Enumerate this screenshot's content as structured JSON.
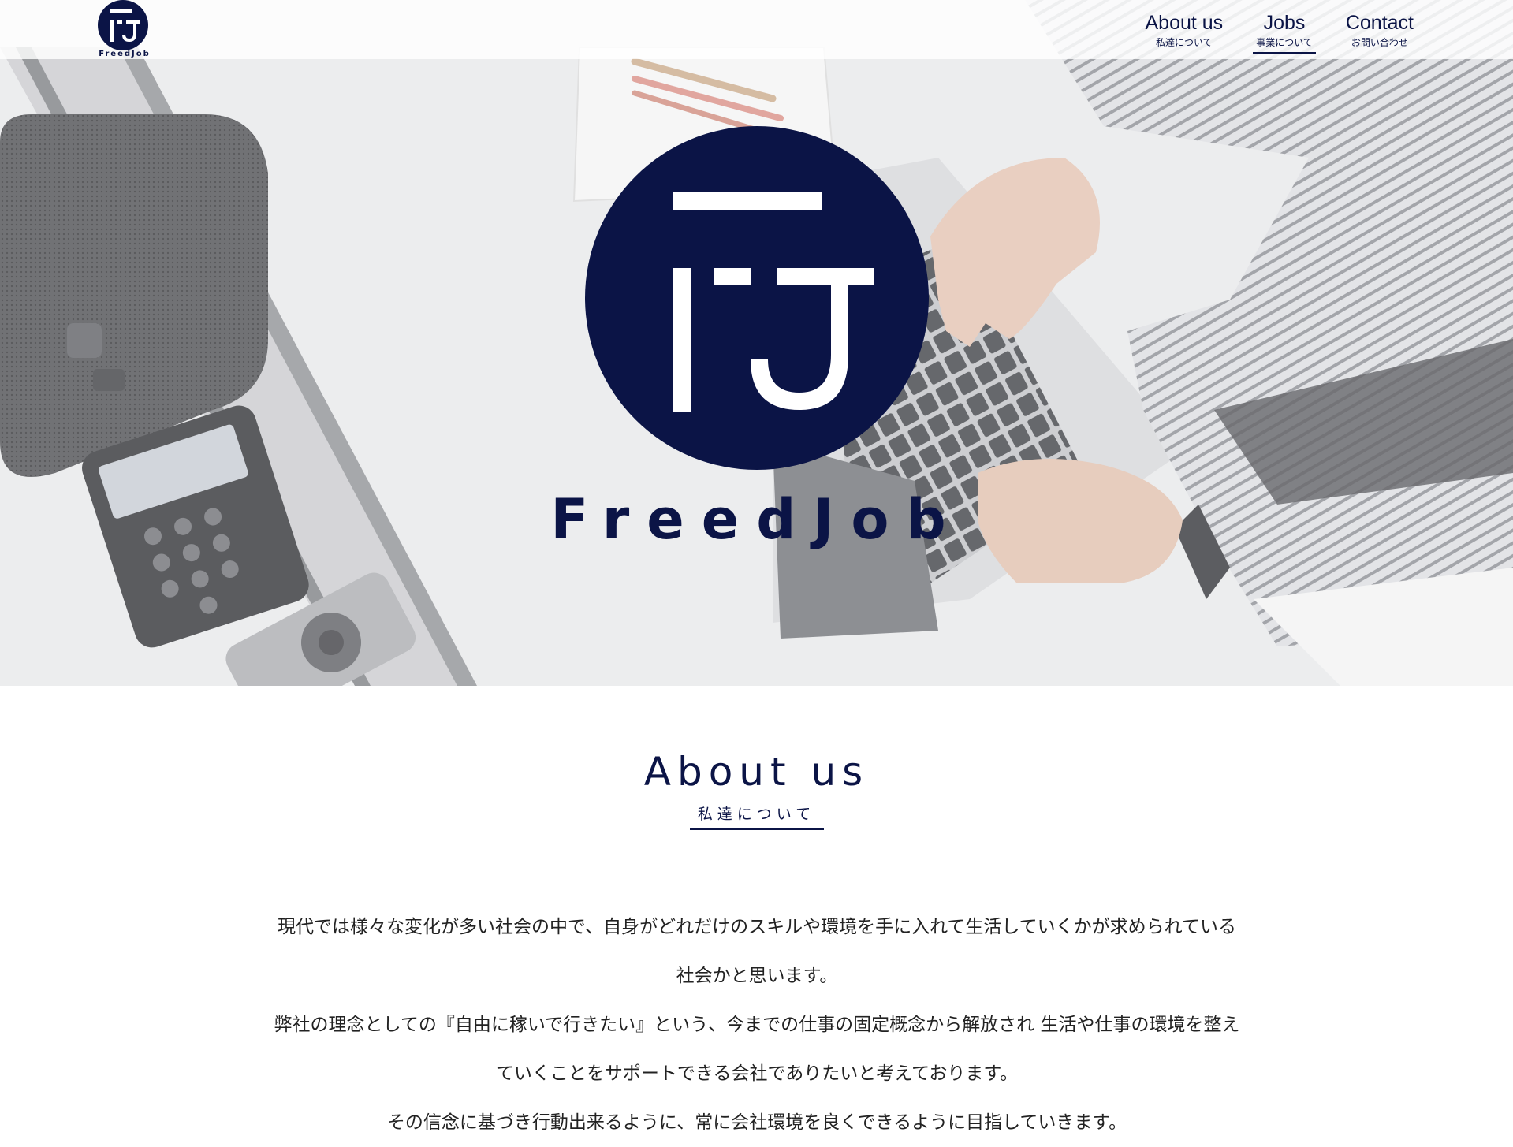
{
  "brand": {
    "name": "FreedJob",
    "color": "#0b1446"
  },
  "nav": [
    {
      "label_en": "About us",
      "label_ja": "私達について",
      "active": false
    },
    {
      "label_en": "Jobs",
      "label_ja": "事業について",
      "active": true
    },
    {
      "label_en": "Contact",
      "label_ja": "お問い合わせ",
      "active": false
    }
  ],
  "hero": {
    "wordmark": "FreedJob",
    "logo_icon": "freedjob-circle-logo"
  },
  "about": {
    "title": "About us",
    "subtitle": "私達について",
    "paragraphs": [
      "現代では様々な変化が多い社会の中で、自身がどれだけのスキルや環境を手に入れて生活していくかが求められている",
      "社会かと思います。",
      "弊社の理念としての『自由に稼いで行きたい』という、今までの仕事の固定概念から解放され 生活や仕事の環境を整え",
      "ていくことをサポートできる会社でありたいと考えております。",
      "その信念に基づき行動出来るように、常に会社環境を良くできるように目指していきます。"
    ]
  }
}
